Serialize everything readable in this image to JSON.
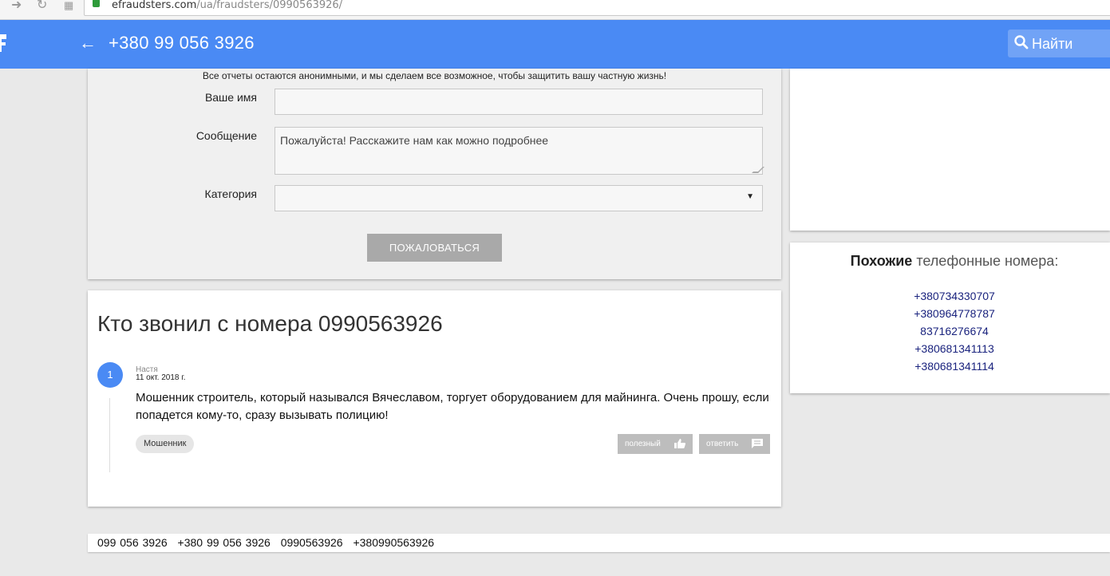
{
  "browser": {
    "url_host": "efraudsters.com",
    "url_path": "/ua/fraudsters/0990563926/"
  },
  "appbar": {
    "title": "+380 99 056 3926",
    "search_placeholder": "Найти"
  },
  "form": {
    "note": "Все отчеты остаются анонимными, и мы сделаем все возможное, чтобы защитить вашу частную жизнь!",
    "name_label": "Ваше имя",
    "name_value": "",
    "message_label": "Сообщение",
    "message_placeholder": "Пожалуйста! Расскажите нам как можно подробнее",
    "category_label": "Категория",
    "category_value": "",
    "submit_label": "ПОЖАЛОВАТЬСЯ"
  },
  "calls": {
    "title": "Кто звонил с номера 0990563926",
    "comments": [
      {
        "number": "1",
        "author": "Настя",
        "date": "11 окт. 2018 г.",
        "text": "Мошенник строитель, который назывался Вячеславом, торгует оборудованием для майнинга. Очень прошу, если попадется кому-то, сразу вызывать полицию!",
        "tag": "Мошенник",
        "useful_label": "полезный",
        "reply_label": "ответить"
      }
    ]
  },
  "similar": {
    "heading_bold": "Похожие",
    "heading_rest": "телефонные номера:",
    "numbers": [
      "+380734330707",
      "+380964778787",
      "83716276674",
      "+380681341113",
      "+380681341114"
    ]
  },
  "footer": {
    "numbers": [
      "099 056 3926",
      "+380 99 056 3926",
      "0990563926",
      "+380990563926"
    ]
  },
  "colors": {
    "appbar": "#4a8af4",
    "link_numbers": "#1a237e",
    "button_grey": "#a9a9a9"
  }
}
